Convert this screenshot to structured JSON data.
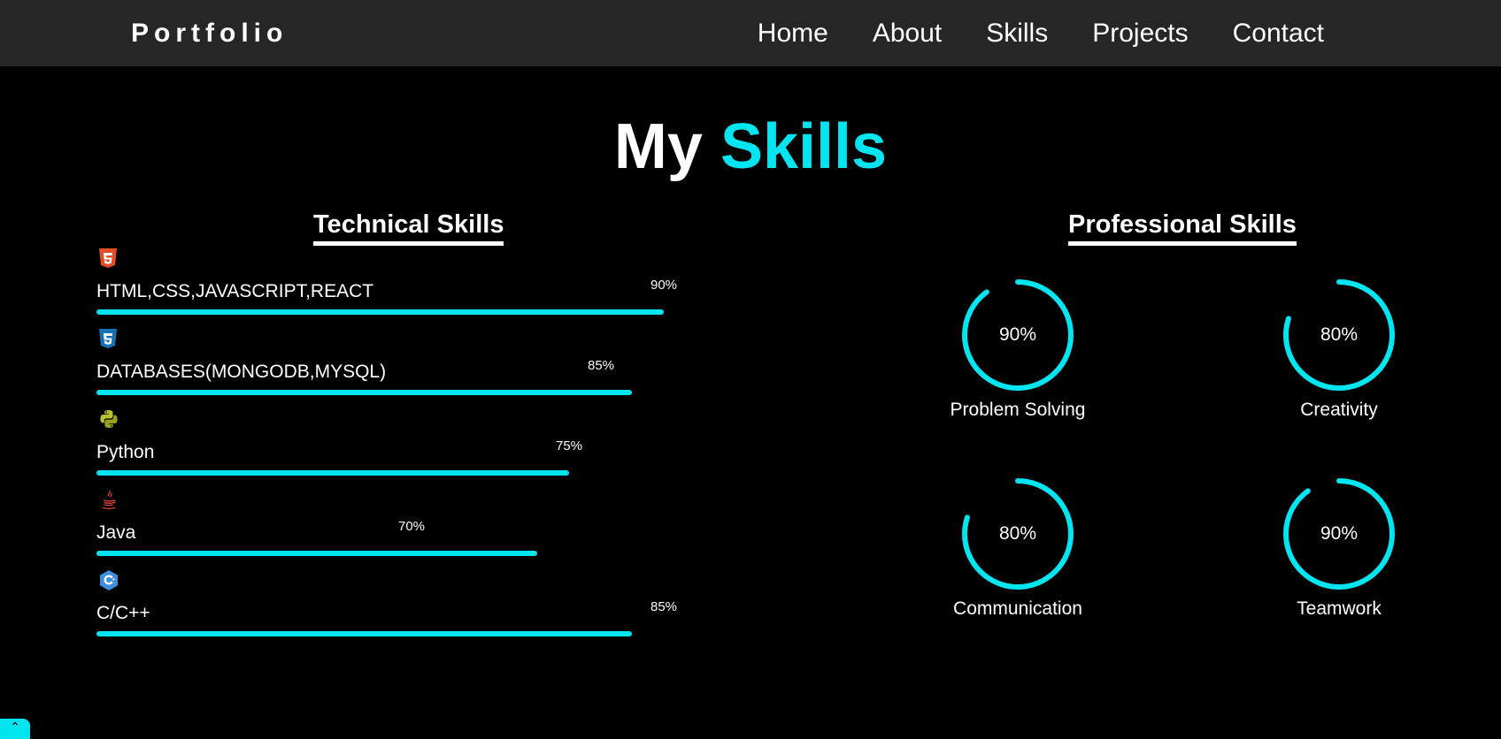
{
  "nav": {
    "logo": "Portfolio",
    "links": [
      "Home",
      "About",
      "Skills",
      "Projects",
      "Contact"
    ]
  },
  "title": {
    "prefix": "My",
    "accent": "Skills"
  },
  "technical": {
    "heading": "Technical Skills",
    "items": [
      {
        "label": "HTML,CSS,JAVASCRIPT,REACT",
        "percent": "90%",
        "value": 90,
        "icon": "html5-icon"
      },
      {
        "label": "DATABASES(MONGODB,MYSQL)",
        "percent": "85%",
        "value": 85,
        "icon": "css3-icon"
      },
      {
        "label": "Python",
        "percent": "75%",
        "value": 75,
        "icon": "python-icon"
      },
      {
        "label": "Java",
        "percent": "70%",
        "value": 70,
        "icon": "java-icon"
      },
      {
        "label": "C/C++",
        "percent": "85%",
        "value": 85,
        "icon": "cpp-icon"
      }
    ]
  },
  "professional": {
    "heading": "Professional Skills",
    "items": [
      {
        "label": "Problem Solving",
        "percent": "90%",
        "value": 90
      },
      {
        "label": "Creativity",
        "percent": "80%",
        "value": 80
      },
      {
        "label": "Communication",
        "percent": "80%",
        "value": 80
      },
      {
        "label": "Teamwork",
        "percent": "90%",
        "value": 90
      }
    ]
  },
  "colors": {
    "accent": "#00e5f0",
    "navbar": "#262626",
    "background": "#000000"
  }
}
